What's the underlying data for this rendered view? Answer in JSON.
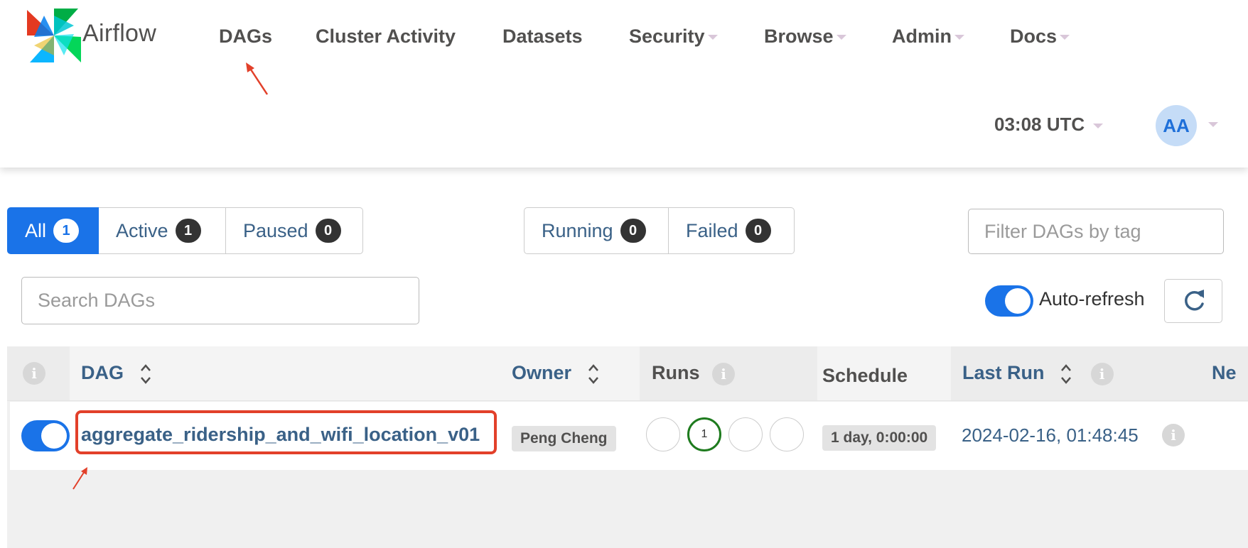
{
  "app": {
    "name": "Airflow"
  },
  "nav": {
    "items": [
      {
        "label": "DAGs"
      },
      {
        "label": "Cluster Activity"
      },
      {
        "label": "Datasets"
      },
      {
        "label": "Security"
      },
      {
        "label": "Browse"
      },
      {
        "label": "Admin"
      },
      {
        "label": "Docs"
      }
    ],
    "time": "03:08 UTC",
    "avatar_initials": "AA"
  },
  "filters": {
    "status": [
      {
        "label": "All",
        "count": "1",
        "active": true
      },
      {
        "label": "Active",
        "count": "1"
      },
      {
        "label": "Paused",
        "count": "0"
      }
    ],
    "runs": [
      {
        "label": "Running",
        "count": "0"
      },
      {
        "label": "Failed",
        "count": "0"
      }
    ],
    "tag_placeholder": "Filter DAGs by tag",
    "search_placeholder": "Search DAGs",
    "auto_refresh_label": "Auto-refresh"
  },
  "table": {
    "headers": {
      "dag": "DAG",
      "owner": "Owner",
      "runs": "Runs",
      "schedule": "Schedule",
      "last_run": "Last Run",
      "next": "Ne"
    },
    "rows": [
      {
        "dag_id": "aggregate_ridership_and_wifi_location_v01",
        "owner": "Peng Cheng",
        "runs": [
          "",
          "1",
          "",
          ""
        ],
        "schedule": "1 day, 0:00:00",
        "last_run": "2024-02-16, 01:48:45"
      }
    ]
  },
  "icons": {
    "info": "info-icon",
    "sort": "sort-icon",
    "refresh": "refresh-icon",
    "caret": "caret-down-icon",
    "logo": "airflow-pinwheel-logo"
  },
  "colors": {
    "primary": "#1a73e8",
    "link": "#3a6187",
    "success": "#1e7b1e",
    "annotation": "#e2402a"
  }
}
